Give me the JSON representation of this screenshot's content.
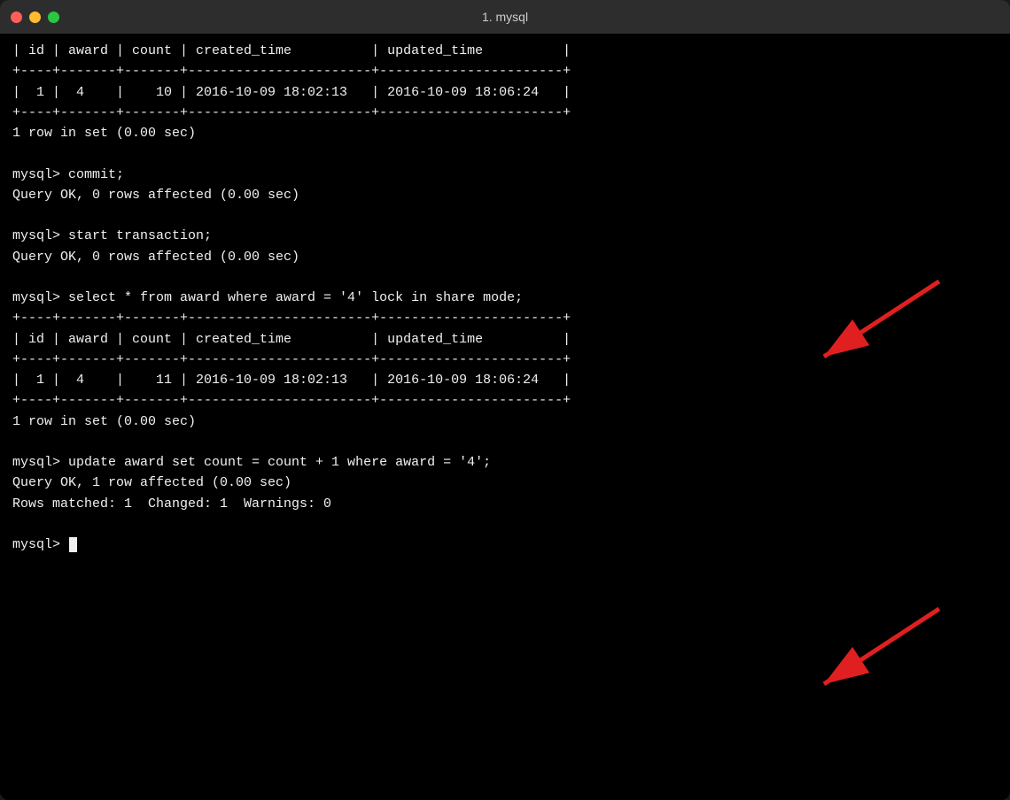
{
  "window": {
    "title": "1. mysql",
    "traffic_lights": {
      "close": "close",
      "minimize": "minimize",
      "maximize": "maximize"
    }
  },
  "terminal": {
    "lines": [
      "| id | award | count | created_time          | updated_time          |",
      "+----+-------+-------+-----------------------+-----------------------+",
      "|  1 |  4    |    10 | 2016-10-09 18:02:13   | 2016-10-09 18:06:24   |",
      "+----+-------+-------+-----------------------+-----------------------+",
      "1 row in set (0.00 sec)",
      "",
      "mysql> commit;",
      "Query OK, 0 rows affected (0.00 sec)",
      "",
      "mysql> start transaction;",
      "Query OK, 0 rows affected (0.00 sec)",
      "",
      "mysql> select * from award where award = '4' lock in share mode;",
      "+----+-------+-------+-----------------------+-----------------------+",
      "| id | award | count | created_time          | updated_time          |",
      "+----+-------+-------+-----------------------+-----------------------+",
      "|  1 |  4    |    11 | 2016-10-09 18:02:13   | 2016-10-09 18:06:24   |",
      "+----+-------+-------+-----------------------+-----------------------+",
      "1 row in set (0.00 sec)",
      "",
      "mysql> update award set count = count + 1 where award = '4';",
      "Query OK, 1 row affected (0.00 sec)",
      "Rows matched: 1  Changed: 1  Warnings: 0",
      "",
      "mysql> "
    ],
    "arrow1": {
      "label": "arrow pointing to select lock in share mode"
    },
    "arrow2": {
      "label": "arrow pointing to update award"
    }
  }
}
